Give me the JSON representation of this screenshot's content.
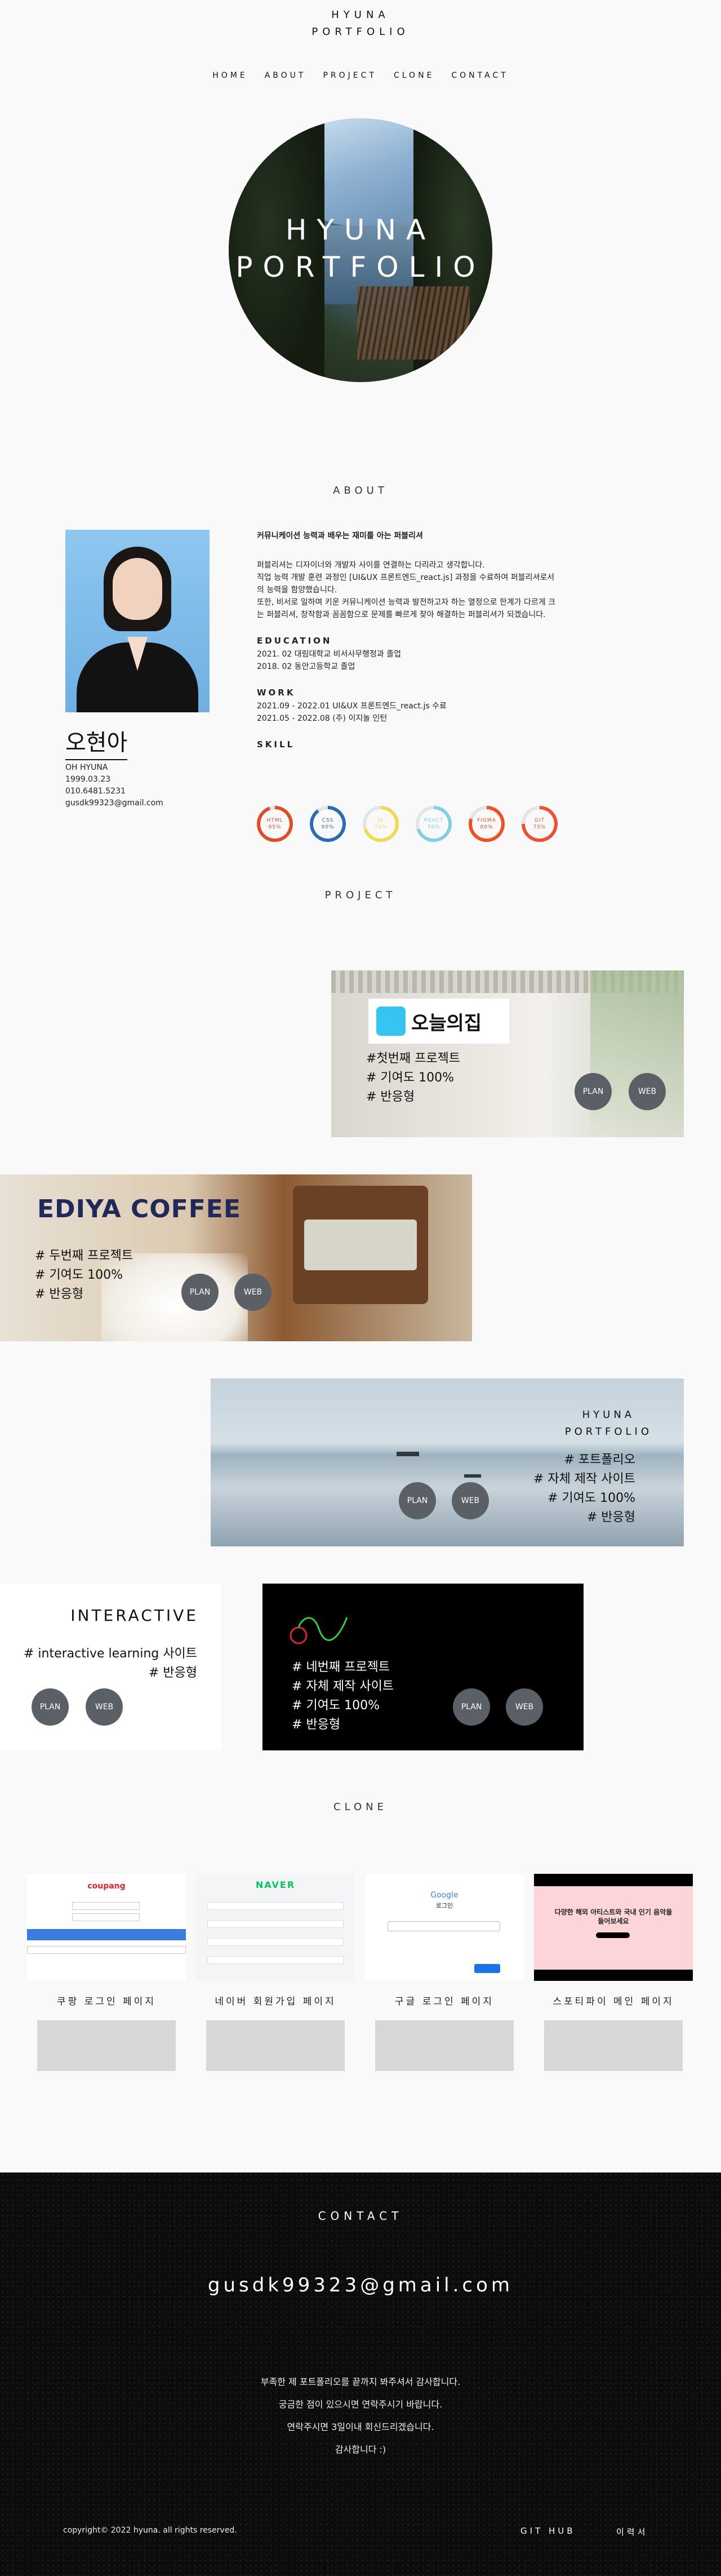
{
  "header": {
    "logo_line1": "HYUNA",
    "logo_line2": "PORTFOLIO"
  },
  "nav": [
    "HOME",
    "ABOUT",
    "PROJECT",
    "CLONE",
    "CONTACT"
  ],
  "hero": {
    "line1": "HYUNA",
    "line2": "PORTFOLIO"
  },
  "about": {
    "title": "ABOUT",
    "name": "오현아",
    "info": [
      "OH HYUNA",
      "1999.03.23",
      "010.6481.5231",
      "gusdk99323@gmail.com"
    ],
    "lead": "커뮤니케이션 능력과 배우는 재미를 아는 퍼블리셔",
    "paragraphs": [
      "퍼블리셔는 디자이너와 개발자 사이를 연결하는 다리라고 생각합니다.",
      "직업 능력 개발 훈련 과정인 [UI&UX 프론트엔드_react.js] 과정을 수료하여 퍼블리셔로서",
      "의 능력을 함양했습니다.",
      "또한, 비서로 일하며 키운 커뮤니케이션 능력과 발전하고자 하는 열정으로 한계가 다르게 크",
      "는 퍼블리셔, 창작함과 꼼꼼함으로 문제를 빠르게 찾아 해결하는 퍼블리셔가 되겠습니다."
    ],
    "education_title": "EDUCATION",
    "education": [
      "2021. 02 대림대학교 비서사무행정과 졸업",
      "2018. 02 동안고등학교 졸업"
    ],
    "work_title": "WORK",
    "work": [
      "2021.09 - 2022.01 UI&UX 프론트엔드_react.js 수료",
      "2021.05 - 2022.08 (주) 이지놀 인턴"
    ],
    "skill_title": "SKILL",
    "skills": [
      {
        "name": "HTML",
        "pct": "95%",
        "color": "#e34c26"
      },
      {
        "name": "CSS",
        "pct": "90%",
        "color": "#2b6cb8"
      },
      {
        "name": "JS",
        "pct": "70%",
        "color": "#f0db4f"
      },
      {
        "name": "REACT",
        "pct": "70%",
        "color": "#7fd0e6"
      },
      {
        "name": "FIGMA",
        "pct": "80%",
        "color": "#f24e1e"
      },
      {
        "name": "GIT",
        "pct": "75%",
        "color": "#f1502f"
      }
    ]
  },
  "project": {
    "title": "PROJECT",
    "p1": {
      "brand": "오늘의집",
      "lines": [
        "#첫번째 프로젝트",
        "# 기여도 100%",
        "# 반응형"
      ]
    },
    "p2": {
      "brand": "EDIYA COFFEE",
      "lines": [
        "# 두번째 프로젝트",
        "# 기여도 100%",
        "# 반응형"
      ]
    },
    "p3": {
      "title1": "HYUNA",
      "title2": "PORTFOLIO",
      "lines": [
        "# 포트폴리오",
        "# 자체 제작 사이트",
        "# 기여도 100%",
        "# 반응형"
      ]
    },
    "p4": {
      "title": "INTERACTIVE",
      "lines": [
        "# interactive learning 사이트",
        "# 반응형"
      ]
    },
    "p5": {
      "lines": [
        "# 네번째 프로젝트",
        "# 자체 제작 사이트",
        "# 기여도 100%",
        "# 반응형"
      ]
    },
    "plan_label": "PLAN",
    "web_label": "WEB"
  },
  "clone": {
    "title": "CLONE",
    "items": [
      "쿠팡 로그인 페이지",
      "네이버 회원가입 페이지",
      "구글 로그인 페이지",
      "스포티파이 메인 페이지"
    ],
    "coupang_logo": "coupang",
    "naver_logo": "NAVER",
    "google_logo": "Google",
    "google_sub": "로그인",
    "spotify_text1": "다양한 해외 아티스트와 국내 인기 음악을",
    "spotify_text2": "들어보세요"
  },
  "contact": {
    "title": "CONTACT",
    "email": "gusdk99323@gmail.com",
    "messages": [
      "부족한 제 포트폴리오를 끝까지 봐주셔서 감사합니다.",
      "궁금한 점이 있으시면 연락주시기 바랍니다.",
      "연락주시면 3일이내 회신드리겠습니다.",
      "감사합니다 :)"
    ],
    "copyright": "copyright© 2022 hyuna. all rights reserved.",
    "github": "GIT HUB",
    "resume": "이력서"
  }
}
